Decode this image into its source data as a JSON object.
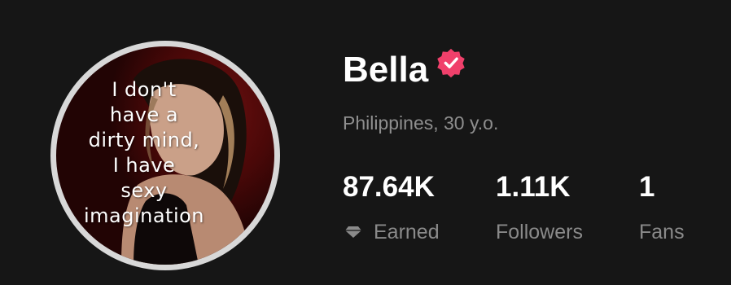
{
  "profile": {
    "name": "Bella",
    "location": "Philippines, 30 y.o.",
    "verified_icon": "verified-badge-icon",
    "accent_color": "#f0406b",
    "avatar": {
      "caption_lines": [
        "I don't",
        "have a",
        "dirty mind,",
        "I have",
        "sexy",
        "imagination"
      ]
    }
  },
  "stats": [
    {
      "value": "87.64K",
      "label": "Earned",
      "icon": "diamond-icon"
    },
    {
      "value": "1.11K",
      "label": "Followers"
    },
    {
      "value": "1",
      "label": "Fans"
    }
  ]
}
